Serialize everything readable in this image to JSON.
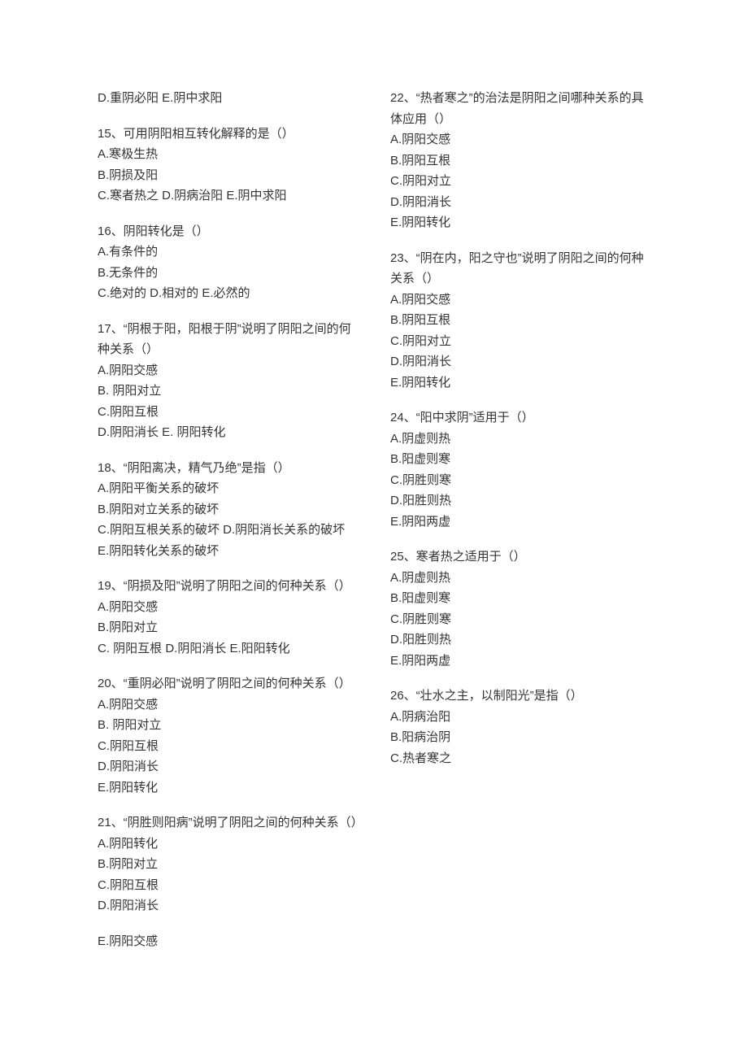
{
  "left_orphan": "D.重阴必阳 E.阴中求阳",
  "right_orphan": "E.阴阳交感",
  "questions": [
    {
      "q": "15、可用阴阳相互转化解释的是（）",
      "opts": [
        "A.寒极生热",
        "B.阴损及阳",
        "C.寒者热之 D.阴病治阳 E.阴中求阳"
      ]
    },
    {
      "q": "16、阴阳转化是（）",
      "opts": [
        "A.有条件的",
        "B.无条件的",
        "C.绝对的 D.相对的 E.必然的"
      ]
    },
    {
      "q": "17、“阴根于阳，阳根于阴”说明了阴阳之间的何种关系（）",
      "opts": [
        "A.阴阳交感",
        "B. 阴阳对立",
        "C.阴阳互根",
        "D.阴阳消长 E. 阴阳转化"
      ]
    },
    {
      "q": "18、“阴阳离决，精气乃绝”是指（）",
      "opts": [
        "A.阴阳平衡关系的破坏",
        "B.阴阳对立关系的破坏",
        "C.阴阳互根关系的破坏 D.阴阳消长关系的破坏 E.阴阳转化关系的破坏"
      ]
    },
    {
      "q": "19、“阴损及阳”说明了阴阳之间的何种关系（）",
      "opts": [
        "A.阴阳交感",
        "B.阴阳对立",
        "C. 阴阳互根 D.阴阳消长 E.阳阳转化"
      ]
    },
    {
      "q": "20、“重阴必阳”说明了阴阳之间的何种关系（）",
      "opts": [
        "A.阴阳交感",
        "B. 阴阳对立",
        "C.阴阳互根",
        "D.阴阳消长",
        "E.阴阳转化"
      ]
    },
    {
      "q": "21、“阴胜则阳病”说明了阴阳之间的何种关系（）",
      "opts": [
        "A.阴阳转化",
        "B.阴阳对立",
        "C.阴阳互根",
        "D.阴阳消长"
      ]
    },
    {
      "q": "22、“热者寒之”的治法是阴阳之间哪种关系的具体应用（）",
      "opts": [
        "A.阴阳交感",
        "B.阴阳互根",
        "C.阴阳对立",
        "D.阴阳消长",
        "E.阴阳转化"
      ]
    },
    {
      "q": "23、“阴在内，阳之守也”说明了阴阳之间的何种关系（）",
      "opts": [
        "A.阴阳交感",
        "B.阴阳互根",
        "C.阴阳对立",
        "D.阴阳消长",
        "E.阴阳转化"
      ]
    },
    {
      "q": "24、“阳中求阴”适用于（）",
      "opts": [
        "A.阴虚则热",
        "B.阳虚则寒",
        "C.阴胜则寒",
        "D.阳胜则热",
        "E.阴阳两虚"
      ]
    },
    {
      "q": "25、寒者热之适用于（）",
      "opts": [
        "A.阴虚则热",
        "B.阳虚则寒",
        "C.阴胜则寒",
        "D.阳胜则热",
        "E.阴阳两虚"
      ]
    },
    {
      "q": "26、“壮水之主，以制阳光”是指（）",
      "opts": [
        "A.阴病治阳",
        "B.阳病治阴",
        "C.热者寒之"
      ]
    }
  ]
}
